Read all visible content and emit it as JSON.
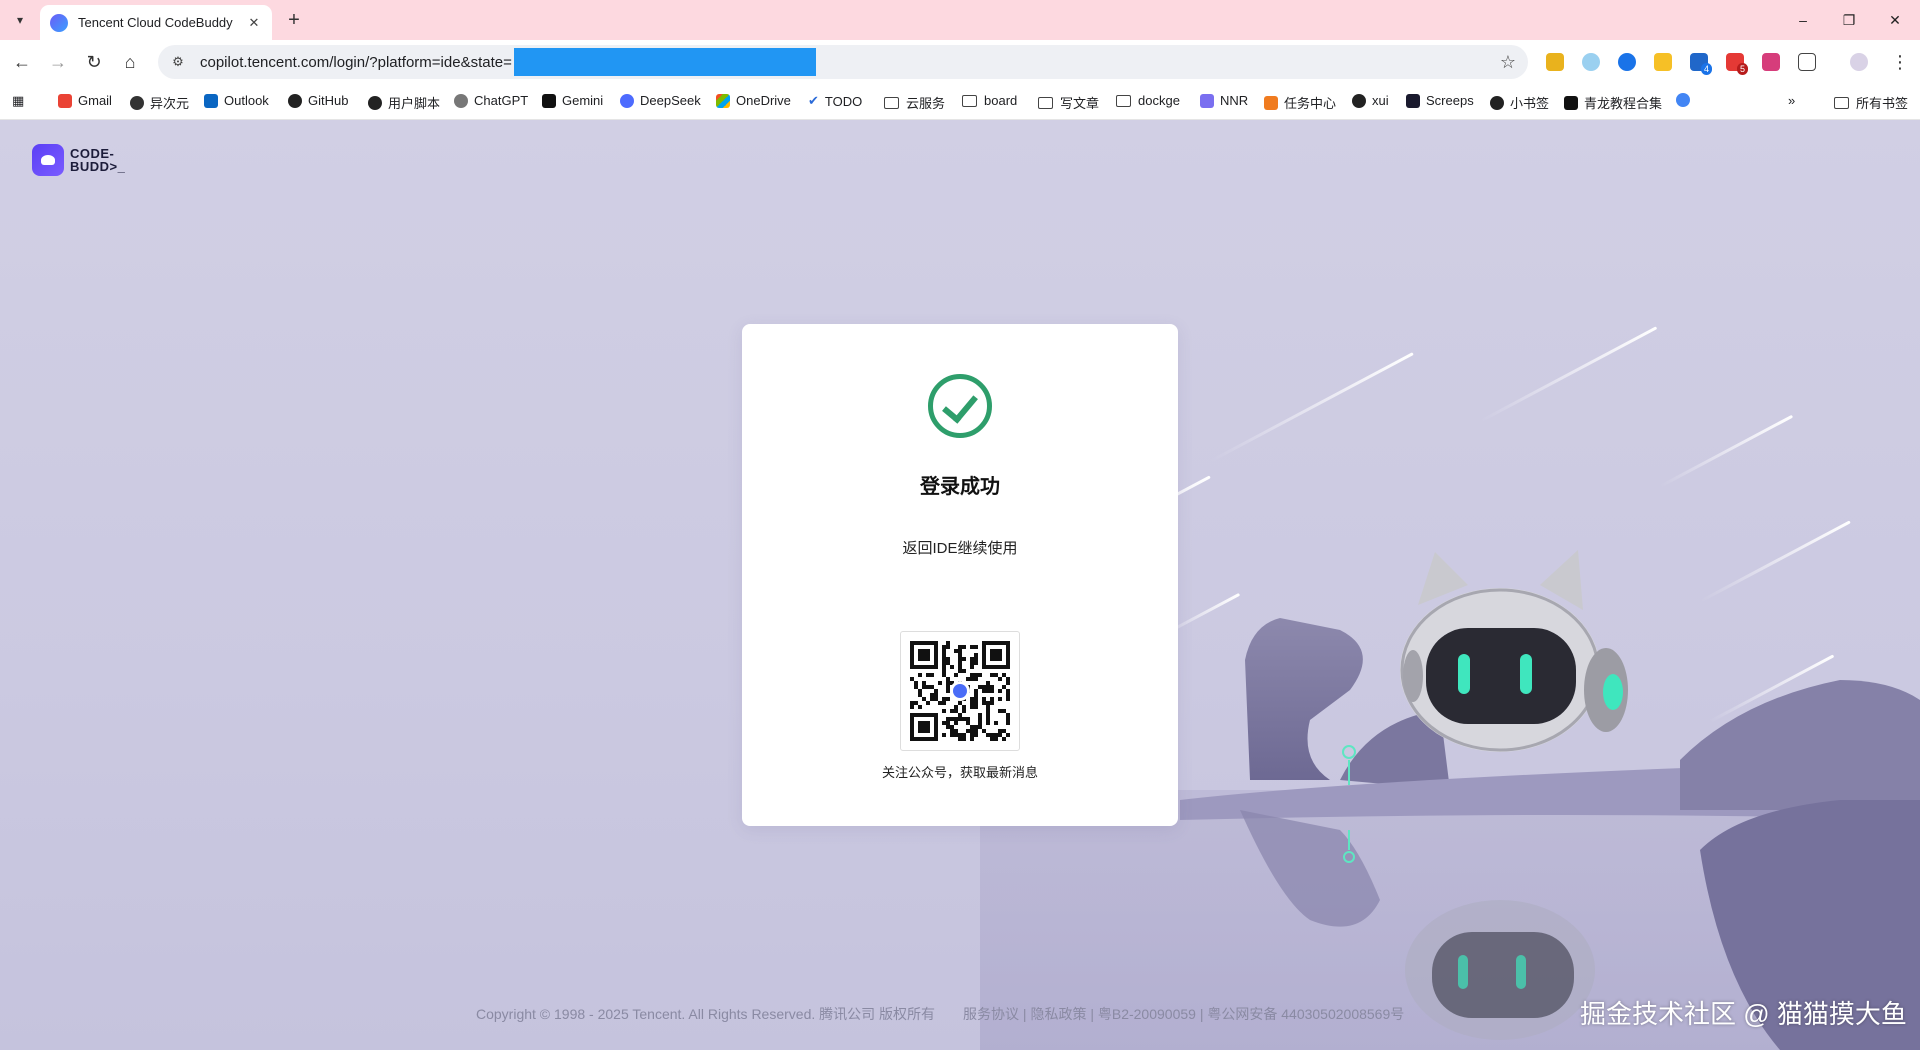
{
  "browser": {
    "tab_title": "Tencent Cloud CodeBuddy",
    "url": "copilot.tencent.com/login/?platform=ide&state=",
    "bookmarks": [
      "Gmail",
      "异次元",
      "Outlook",
      "GitHub",
      "用户脚本",
      "ChatGPT",
      "Gemini",
      "DeepSeek",
      "OneDrive",
      "TODO",
      "云服务",
      "board",
      "写文章",
      "dockge",
      "NNR",
      "任务中心",
      "xui",
      "Screeps",
      "小书签",
      "青龙教程合集"
    ],
    "all_bookmarks": "所有书签",
    "extension_badges": [
      "4",
      "5"
    ]
  },
  "page": {
    "logo_text": "CODE-BUDD>_",
    "title": "登录成功",
    "subtitle": "返回IDE继续使用",
    "qr_caption": "关注公众号，获取最新消息",
    "footer_copyright": "Copyright © 1998 - 2025 Tencent. All Rights Reserved. 腾讯公司 版权所有",
    "footer_links": "服务协议 | 隐私政策 | 粤B2-20090059 | 粤公网安备 44030502008569号",
    "watermark": "掘金技术社区 @ 猫猫摸大鱼"
  },
  "colors": {
    "success": "#2e9e6b",
    "tabbar": "#fdd9e0",
    "page_bg": "#cfcde3",
    "redact": "#2196f3"
  }
}
